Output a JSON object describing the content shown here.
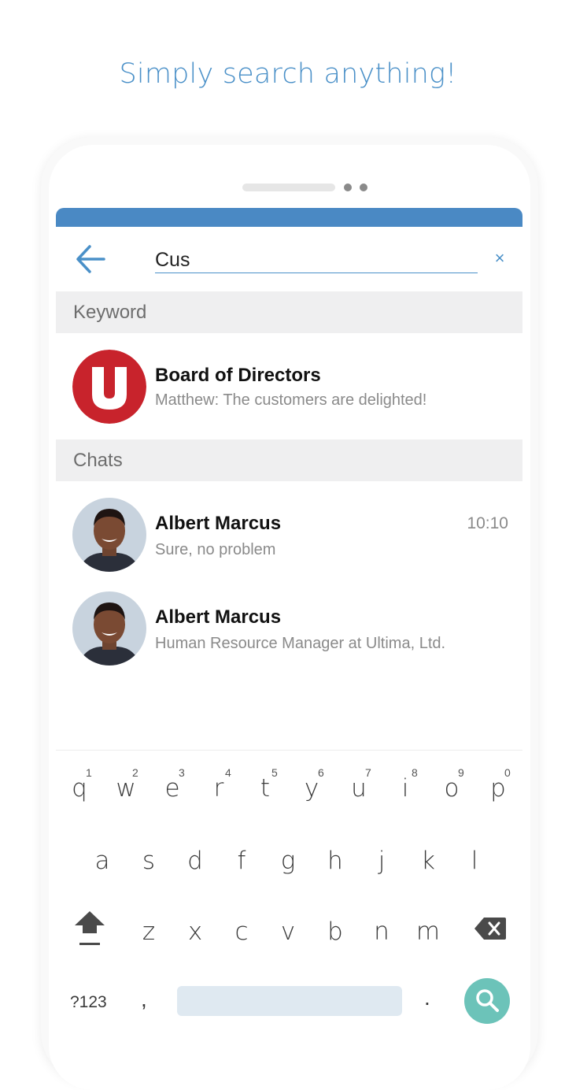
{
  "headline": "Simply search anything!",
  "search": {
    "value": "Cus",
    "clear_glyph": "×"
  },
  "sections": {
    "keyword": "Keyword",
    "chats": "Chats"
  },
  "keyword_result": {
    "title": "Board of Directors",
    "subtitle": "Matthew: The customers are delighted!",
    "avatar_icon": "u-logo-icon",
    "avatar_color": "#c8232c"
  },
  "chat_results": [
    {
      "name": "Albert Marcus",
      "message": "Sure, no problem",
      "time": "10:10"
    },
    {
      "name": "Albert Marcus",
      "message": "Human Resource Manager at Ultima, Ltd.",
      "time": ""
    }
  ],
  "keyboard": {
    "row1": [
      {
        "k": "q",
        "h": "1"
      },
      {
        "k": "w",
        "h": "2"
      },
      {
        "k": "e",
        "h": "3"
      },
      {
        "k": "r",
        "h": "4"
      },
      {
        "k": "t",
        "h": "5"
      },
      {
        "k": "y",
        "h": "6"
      },
      {
        "k": "u",
        "h": "7"
      },
      {
        "k": "i",
        "h": "8"
      },
      {
        "k": "o",
        "h": "9"
      },
      {
        "k": "p",
        "h": "0"
      }
    ],
    "row2": [
      "a",
      "s",
      "d",
      "f",
      "g",
      "h",
      "j",
      "k",
      "l"
    ],
    "row3": [
      "z",
      "x",
      "c",
      "v",
      "b",
      "n",
      "m"
    ],
    "symbols_label": "?123",
    "comma_label": ",",
    "period_label": "."
  },
  "colors": {
    "accent": "#4a90c8",
    "status_bar": "#4a89c4",
    "search_key": "#6cc3b9"
  }
}
